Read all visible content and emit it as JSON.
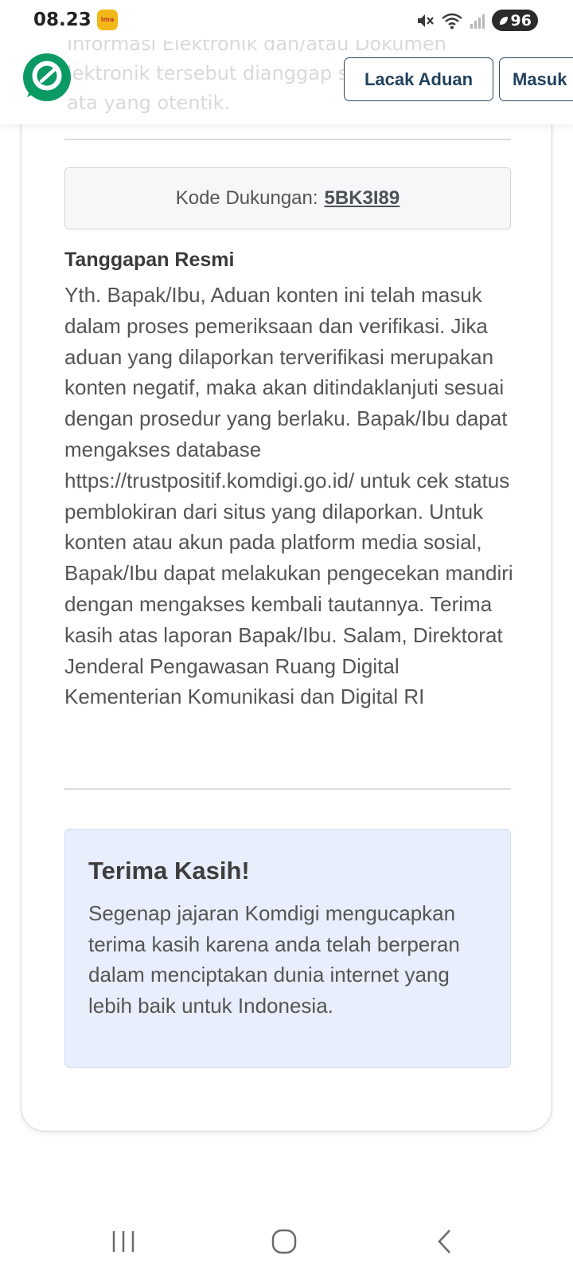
{
  "status_bar": {
    "time": "08.23",
    "notification_badge": "ima",
    "battery": "96",
    "icons": [
      "mute-icon",
      "wifi-icon",
      "signal-icon",
      "battery-saver-icon"
    ]
  },
  "header": {
    "background_text": [
      "Informasi Elektronik dan/atau Dokumen",
      "lektronik tersebut dianggap sesuah oleh",
      "ata yang otentik."
    ],
    "logo_icon": "komdigi-logo",
    "track_button": "Lacak Aduan",
    "login_button": "Masuk"
  },
  "support_code": {
    "label": "Kode Dukungan:",
    "value": "5BK3I89"
  },
  "official_response": {
    "title": "Tanggapan Resmi",
    "body": "Yth. Bapak/Ibu, Aduan konten ini telah masuk dalam proses pemeriksaan dan verifikasi. Jika aduan yang dilaporkan terverifikasi merupakan konten negatif, maka akan ditindaklanjuti sesuai dengan prosedur yang berlaku. Bapak/Ibu dapat mengakses database https://trustpositif.komdigi.go.id/ untuk cek status pemblokiran dari situs yang dilaporkan. Untuk konten atau akun pada platform media sosial, Bapak/Ibu dapat melakukan pengecekan mandiri dengan mengakses kembali tautannya. Terima kasih atas laporan Bapak/Ibu. Salam, Direktorat Jenderal Pengawasan Ruang Digital Kementerian Komunikasi dan Digital RI"
  },
  "thanks": {
    "title": "Terima Kasih!",
    "text": "Segenap jajaran Komdigi mengucapkan terima kasih karena anda telah berperan dalam menciptakan dunia internet yang lebih baik untuk Indonesia."
  },
  "nav_bar": {
    "icons": [
      "recent-apps-icon",
      "home-icon",
      "back-icon"
    ]
  },
  "colors": {
    "brand_green": "#0b9a63",
    "button_border": "#2c4a63",
    "thanks_bg": "#e8eefb"
  }
}
